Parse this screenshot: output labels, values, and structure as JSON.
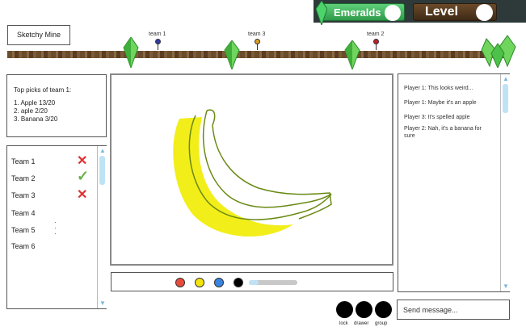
{
  "header": {
    "emeralds_label": "Emeralds",
    "level_label": "Level"
  },
  "title": "Sketchy Mine",
  "progress": {
    "markers": [
      {
        "label": "team 1",
        "color": "#2f3aa8"
      },
      {
        "label": "team 3",
        "color": "#e0a020"
      },
      {
        "label": "team 2",
        "color": "#c0202a"
      }
    ]
  },
  "picks": {
    "heading": "Top picks of team 1:",
    "items": [
      "1. Apple 13/20",
      "2. aple 2/20",
      "3. Banana 3/20"
    ]
  },
  "teams": [
    {
      "name": "Team 1",
      "status": "wrong"
    },
    {
      "name": "Team 2",
      "status": "correct"
    },
    {
      "name": "Team 3",
      "status": "wrong"
    },
    {
      "name": "Team 4",
      "status": ""
    },
    {
      "name": "Team 5",
      "status": ""
    },
    {
      "name": "Team 6",
      "status": ""
    }
  ],
  "palette": {
    "colors": [
      "#e84b3c",
      "#f4e40c",
      "#3a84e0",
      "#000000"
    ],
    "brush_size": 0.2
  },
  "chat": [
    "Player 1: This looks weird...",
    "Player 1: Maybe it's an apple",
    "Player 3: It's spelled apple",
    "Player 2: Nah, it's a banana for sure"
  ],
  "bottom_buttons": [
    "lock",
    "drawer",
    "group"
  ],
  "send_placeholder": "Send message..."
}
